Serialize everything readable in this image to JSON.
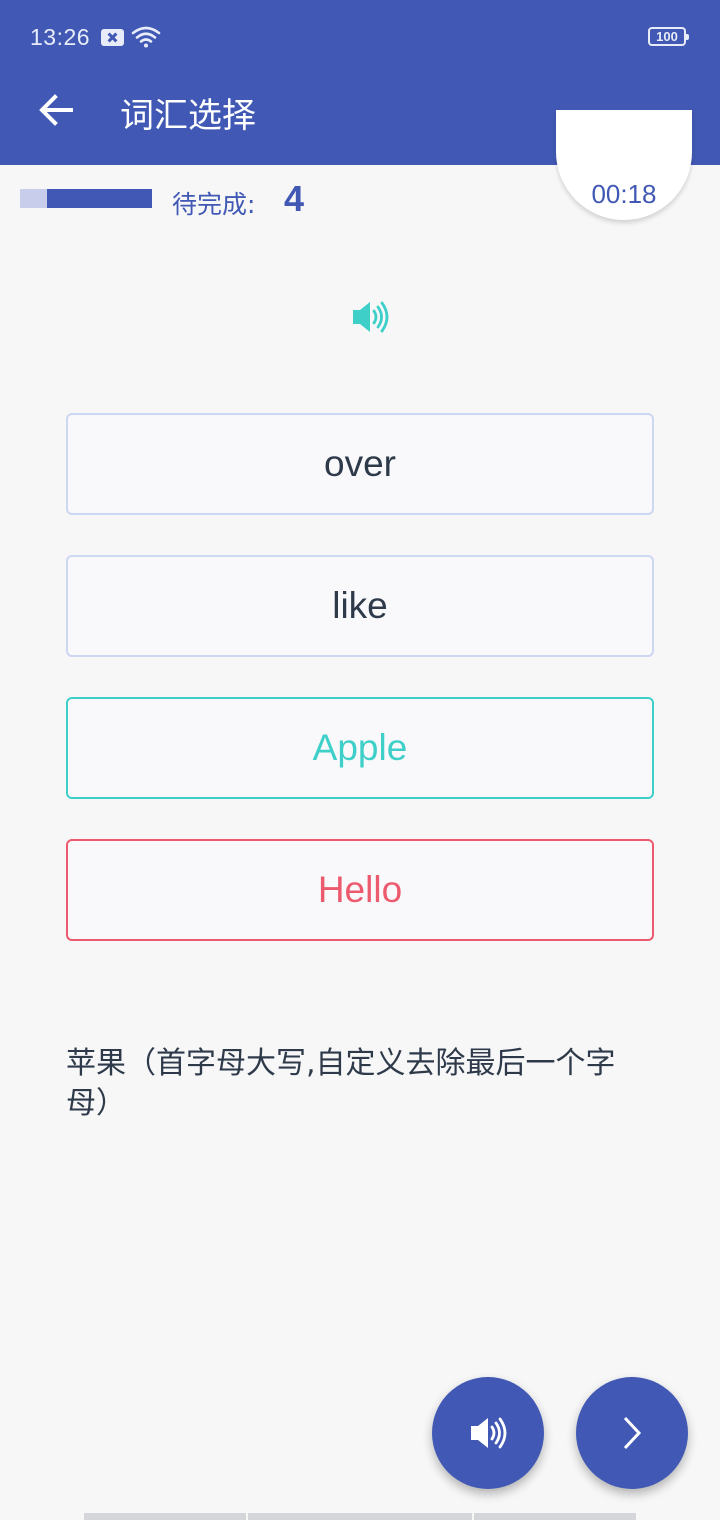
{
  "status_bar": {
    "time": "13:26",
    "battery": "100",
    "icons": [
      "notification-x-icon",
      "wifi-icon",
      "battery-icon"
    ]
  },
  "app_bar": {
    "title": "词汇选择",
    "back_icon": "arrow-left-icon",
    "background_color": "#4159b4"
  },
  "progress": {
    "fraction_complete": 0.8,
    "pending_label": "待完成:",
    "pending_count": "4"
  },
  "timer": "00:18",
  "pronounce_icon": "speaker-icon",
  "options": [
    {
      "text": "over",
      "state": "neutral"
    },
    {
      "text": "like",
      "state": "neutral"
    },
    {
      "text": "Apple",
      "state": "correct"
    },
    {
      "text": "Hello",
      "state": "wrong"
    }
  ],
  "definition": "苹果（首字母大写,自定义去除最后一个字母）",
  "fabs": {
    "speaker_icon": "speaker-icon",
    "next_icon": "chevron-right-icon"
  },
  "colors": {
    "primary": "#4159b4",
    "correct": "#3ecfc9",
    "wrong": "#ec5a6e",
    "neutral_border": "#cdd6f2"
  }
}
